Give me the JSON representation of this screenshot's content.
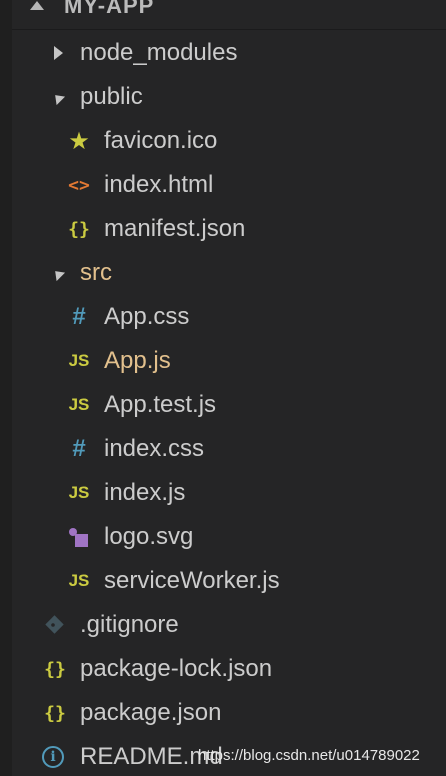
{
  "explorer": {
    "folder_title": "MY-APP"
  },
  "colors": {
    "folder_text": "#cccccc",
    "highlight_text": "#e2c08d",
    "js_icon": "#cbcb41",
    "css_icon": "#519aba",
    "json_icon": "#cbcb41",
    "html_icon": "#e37933",
    "favicon_icon": "#cbcb41",
    "svg_icon": "#a074c4",
    "git_icon": "#41535b",
    "info_icon": "#519aba"
  },
  "tree": [
    {
      "label": "node_modules",
      "depth": 0,
      "type": "folder",
      "state": "collapsed",
      "name": "tree-item-node-modules"
    },
    {
      "label": "public",
      "depth": 0,
      "type": "folder",
      "state": "expanded",
      "name": "tree-item-public"
    },
    {
      "label": "favicon.ico",
      "depth": 1,
      "type": "file",
      "icon": "star-icon",
      "glyph": "★",
      "color": "#cbcb41",
      "name": "tree-item-favicon"
    },
    {
      "label": "index.html",
      "depth": 1,
      "type": "file",
      "icon": "html-icon",
      "glyph": "<>",
      "color": "#e37933",
      "name": "tree-item-index-html"
    },
    {
      "label": "manifest.json",
      "depth": 1,
      "type": "file",
      "icon": "json-icon",
      "glyph": "{}",
      "color": "#cbcb41",
      "name": "tree-item-manifest-json"
    },
    {
      "label": "src",
      "depth": 0,
      "type": "folder",
      "state": "expanded",
      "highlight": true,
      "name": "tree-item-src"
    },
    {
      "label": "App.css",
      "depth": 1,
      "type": "file",
      "icon": "css-icon",
      "glyph": "#",
      "color": "#519aba",
      "name": "tree-item-app-css"
    },
    {
      "label": "App.js",
      "depth": 1,
      "type": "file",
      "icon": "js-icon",
      "glyph": "JS",
      "color": "#cbcb41",
      "highlight": true,
      "name": "tree-item-app-js"
    },
    {
      "label": "App.test.js",
      "depth": 1,
      "type": "file",
      "icon": "js-icon",
      "glyph": "JS",
      "color": "#cbcb41",
      "name": "tree-item-app-test-js"
    },
    {
      "label": "index.css",
      "depth": 1,
      "type": "file",
      "icon": "css-icon",
      "glyph": "#",
      "color": "#519aba",
      "name": "tree-item-index-css"
    },
    {
      "label": "index.js",
      "depth": 1,
      "type": "file",
      "icon": "js-icon",
      "glyph": "JS",
      "color": "#cbcb41",
      "name": "tree-item-index-js"
    },
    {
      "label": "logo.svg",
      "depth": 1,
      "type": "file",
      "icon": "svg-icon",
      "color": "#a074c4",
      "name": "tree-item-logo-svg"
    },
    {
      "label": "serviceWorker.js",
      "depth": 1,
      "type": "file",
      "icon": "js-icon",
      "glyph": "JS",
      "color": "#cbcb41",
      "name": "tree-item-service-worker-js"
    },
    {
      "label": ".gitignore",
      "depth": 0,
      "type": "file",
      "icon": "git-icon",
      "color": "#41535b",
      "name": "tree-item-gitignore"
    },
    {
      "label": "package-lock.json",
      "depth": 0,
      "type": "file",
      "icon": "json-icon",
      "glyph": "{}",
      "color": "#cbcb41",
      "name": "tree-item-package-lock-json"
    },
    {
      "label": "package.json",
      "depth": 0,
      "type": "file",
      "icon": "json-icon",
      "glyph": "{}",
      "color": "#cbcb41",
      "name": "tree-item-package-json"
    },
    {
      "label": "README.md",
      "depth": 0,
      "type": "file",
      "icon": "info-icon",
      "glyph": "i",
      "color": "#519aba",
      "name": "tree-item-readme"
    }
  ],
  "watermark": "https://blog.csdn.net/u014789022"
}
